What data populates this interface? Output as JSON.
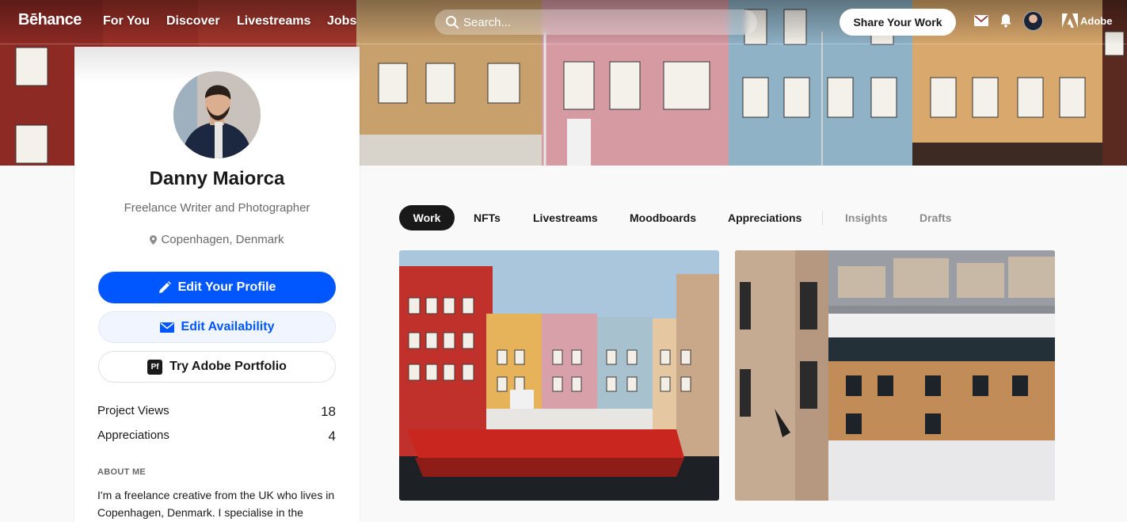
{
  "nav": {
    "logo": "Bēhance",
    "links": [
      "For You",
      "Discover",
      "Livestreams",
      "Jobs"
    ],
    "search_placeholder": "Search...",
    "share_label": "Share Your Work",
    "adobe_label": "Adobe",
    "icons": [
      "search-icon",
      "mail-icon",
      "bell-icon",
      "adobe-icon"
    ]
  },
  "profile": {
    "name": "Danny Maiorca",
    "occupation": "Freelance Writer and Photographer",
    "location": "Copenhagen, Denmark",
    "buttons": {
      "edit_profile": "Edit Your Profile",
      "edit_availability": "Edit Availability",
      "portfolio": "Try Adobe Portfolio",
      "portfolio_badge": "Pf"
    },
    "stats": [
      {
        "label": "Project Views",
        "value": "18"
      },
      {
        "label": "Appreciations",
        "value": "4"
      }
    ],
    "about_title": "ABOUT ME",
    "about_text": "I'm a freelance creative from the UK who lives in Copenhagen, Denmark. I specialise in the"
  },
  "tabs": [
    "Work",
    "NFTs",
    "Livestreams",
    "Moodboards",
    "Appreciations",
    "Insights",
    "Drafts"
  ],
  "colors": {
    "primary": "#0057ff",
    "dark": "#191919",
    "muted": "#696969",
    "page_bg": "#f9f9f9"
  }
}
